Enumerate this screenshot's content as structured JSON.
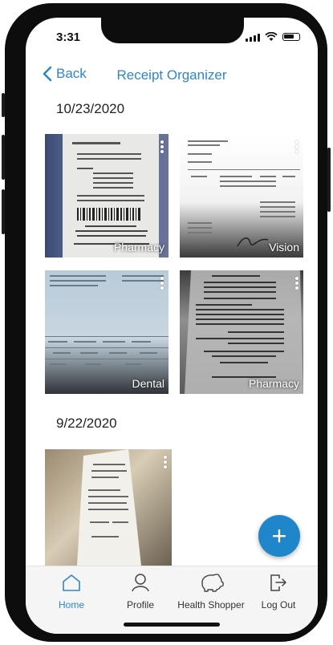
{
  "status": {
    "time": "3:31"
  },
  "nav": {
    "back_label": "Back",
    "title": "Receipt Organizer"
  },
  "sections": [
    {
      "date": "10/23/2020",
      "receipts": [
        {
          "category": "Pharmacy"
        },
        {
          "category": "Vision"
        },
        {
          "category": "Dental"
        },
        {
          "category": "Pharmacy"
        }
      ]
    },
    {
      "date": "9/22/2020",
      "receipts": [
        {
          "category": ""
        }
      ]
    }
  ],
  "tabs": [
    {
      "label": "Home",
      "icon": "home-icon",
      "active": true
    },
    {
      "label": "Profile",
      "icon": "profile-icon",
      "active": false
    },
    {
      "label": "Health Shopper",
      "icon": "piggy-bank-icon",
      "active": false
    },
    {
      "label": "Log Out",
      "icon": "logout-icon",
      "active": false
    }
  ],
  "fab": {
    "symbol": "+"
  },
  "colors": {
    "accent": "#2f86c6",
    "fab": "#1f87c9"
  }
}
